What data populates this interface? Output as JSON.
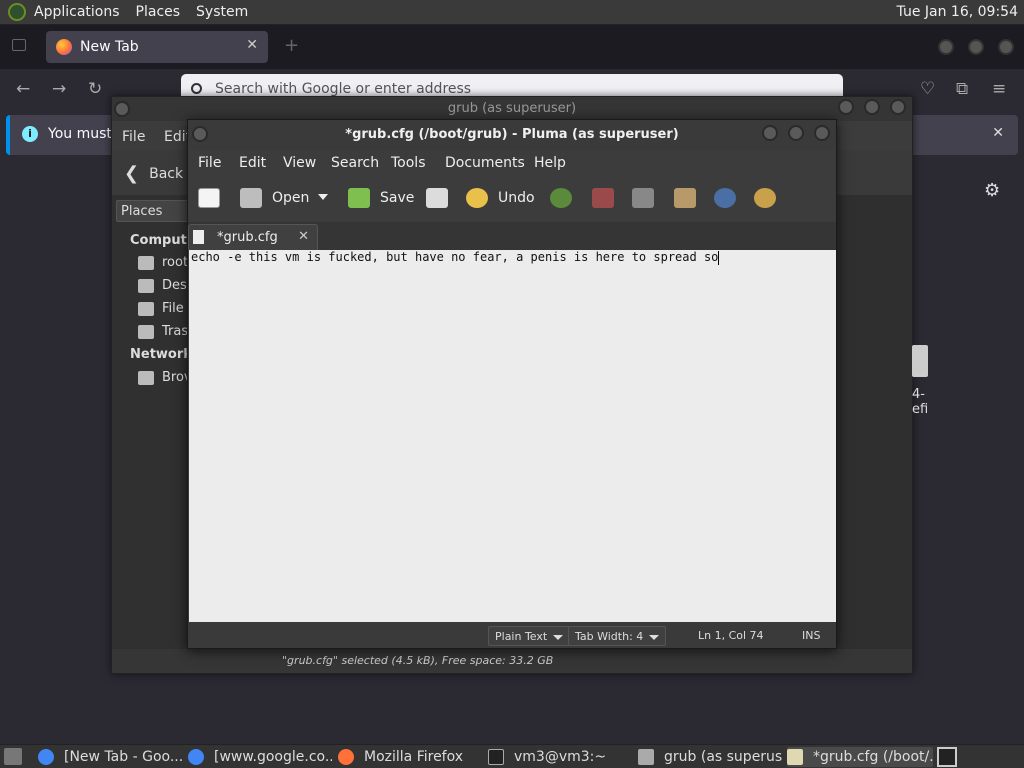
{
  "top_panel": {
    "menu": [
      "Applications",
      "Places",
      "System"
    ],
    "clock": "Tue Jan 16, 09:54"
  },
  "firefox": {
    "tab_title": "New Tab",
    "url_placeholder": "Search with Google or enter address",
    "notice_text": "You must lo"
  },
  "caja": {
    "title": "grub (as superuser)",
    "menu": [
      "File",
      "Edit"
    ],
    "back_label": "Back",
    "places_label": "Places",
    "sidebar": {
      "computer_header": "Compute",
      "computer_items": [
        "root",
        "Des",
        "File",
        "Tras"
      ],
      "network_header": "Network",
      "network_items": [
        "Brov"
      ]
    },
    "file_label": "4-efi",
    "status": "\"grub.cfg\" selected (4.5 kB), Free space: 33.2 GB"
  },
  "pluma": {
    "title": "*grub.cfg (/boot/grub) - Pluma (as superuser)",
    "menu": [
      "File",
      "Edit",
      "View",
      "Search",
      "Tools",
      "Documents",
      "Help"
    ],
    "toolbar": {
      "open": "Open",
      "save": "Save",
      "undo": "Undo"
    },
    "tab_label": "*grub.cfg",
    "editor_text": "echo -e this vm is fucked, but have no fear, a penis is here to spread so",
    "status": {
      "language": "Plain Text",
      "tab_width": "Tab Width:  4",
      "position": "Ln 1, Col 74",
      "mode": "INS"
    }
  },
  "taskbar": {
    "items": [
      "[New Tab - Goo...",
      "[www.google.co...",
      "Mozilla Firefox",
      "vm3@vm3:~",
      "grub (as superuser)",
      "*grub.cfg (/boot/..."
    ]
  },
  "colors": {
    "panel": "#3a3a3a",
    "firefox_accent": "#0090ed",
    "editor_bg": "#ececec"
  }
}
